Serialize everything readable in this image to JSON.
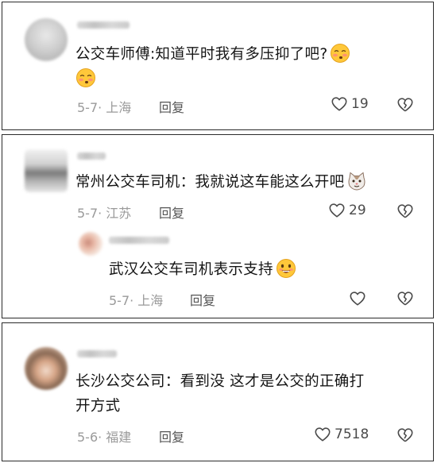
{
  "comments": [
    {
      "text": "公交车师傅:知道平时我有多压抑了吧?",
      "emoji_names": [
        "flushed-blush-emoji",
        "flushed-blush-emoji"
      ],
      "meta": "5-7· 上海",
      "reply_label": "回复",
      "likes": "19"
    },
    {
      "text": "常州公交车司机：我就说这车能这么开吧",
      "emoji_names": [
        "cat-face-emoji"
      ],
      "meta": "5-7· 江苏",
      "reply_label": "回复",
      "likes": "29",
      "sub_reply": {
        "text": "武汉公交车司机表示支持",
        "emoji_names": [
          "grinning-face-emoji"
        ],
        "meta": "5-7· 上海",
        "reply_label": "回复"
      }
    },
    {
      "text_line1": "长沙公交公司：看到没 这才是公交的正确打",
      "text_line2": "开方式",
      "meta": "5-6· 福建",
      "reply_label": "回复",
      "likes": "7518"
    }
  ],
  "icons": {
    "like": "heart-outline-icon",
    "dislike": "broken-heart-icon"
  },
  "colors": {
    "text": "#151515",
    "meta": "#9a9a9a",
    "icon": "#4a4a4a",
    "border": "#2a2a2a"
  }
}
